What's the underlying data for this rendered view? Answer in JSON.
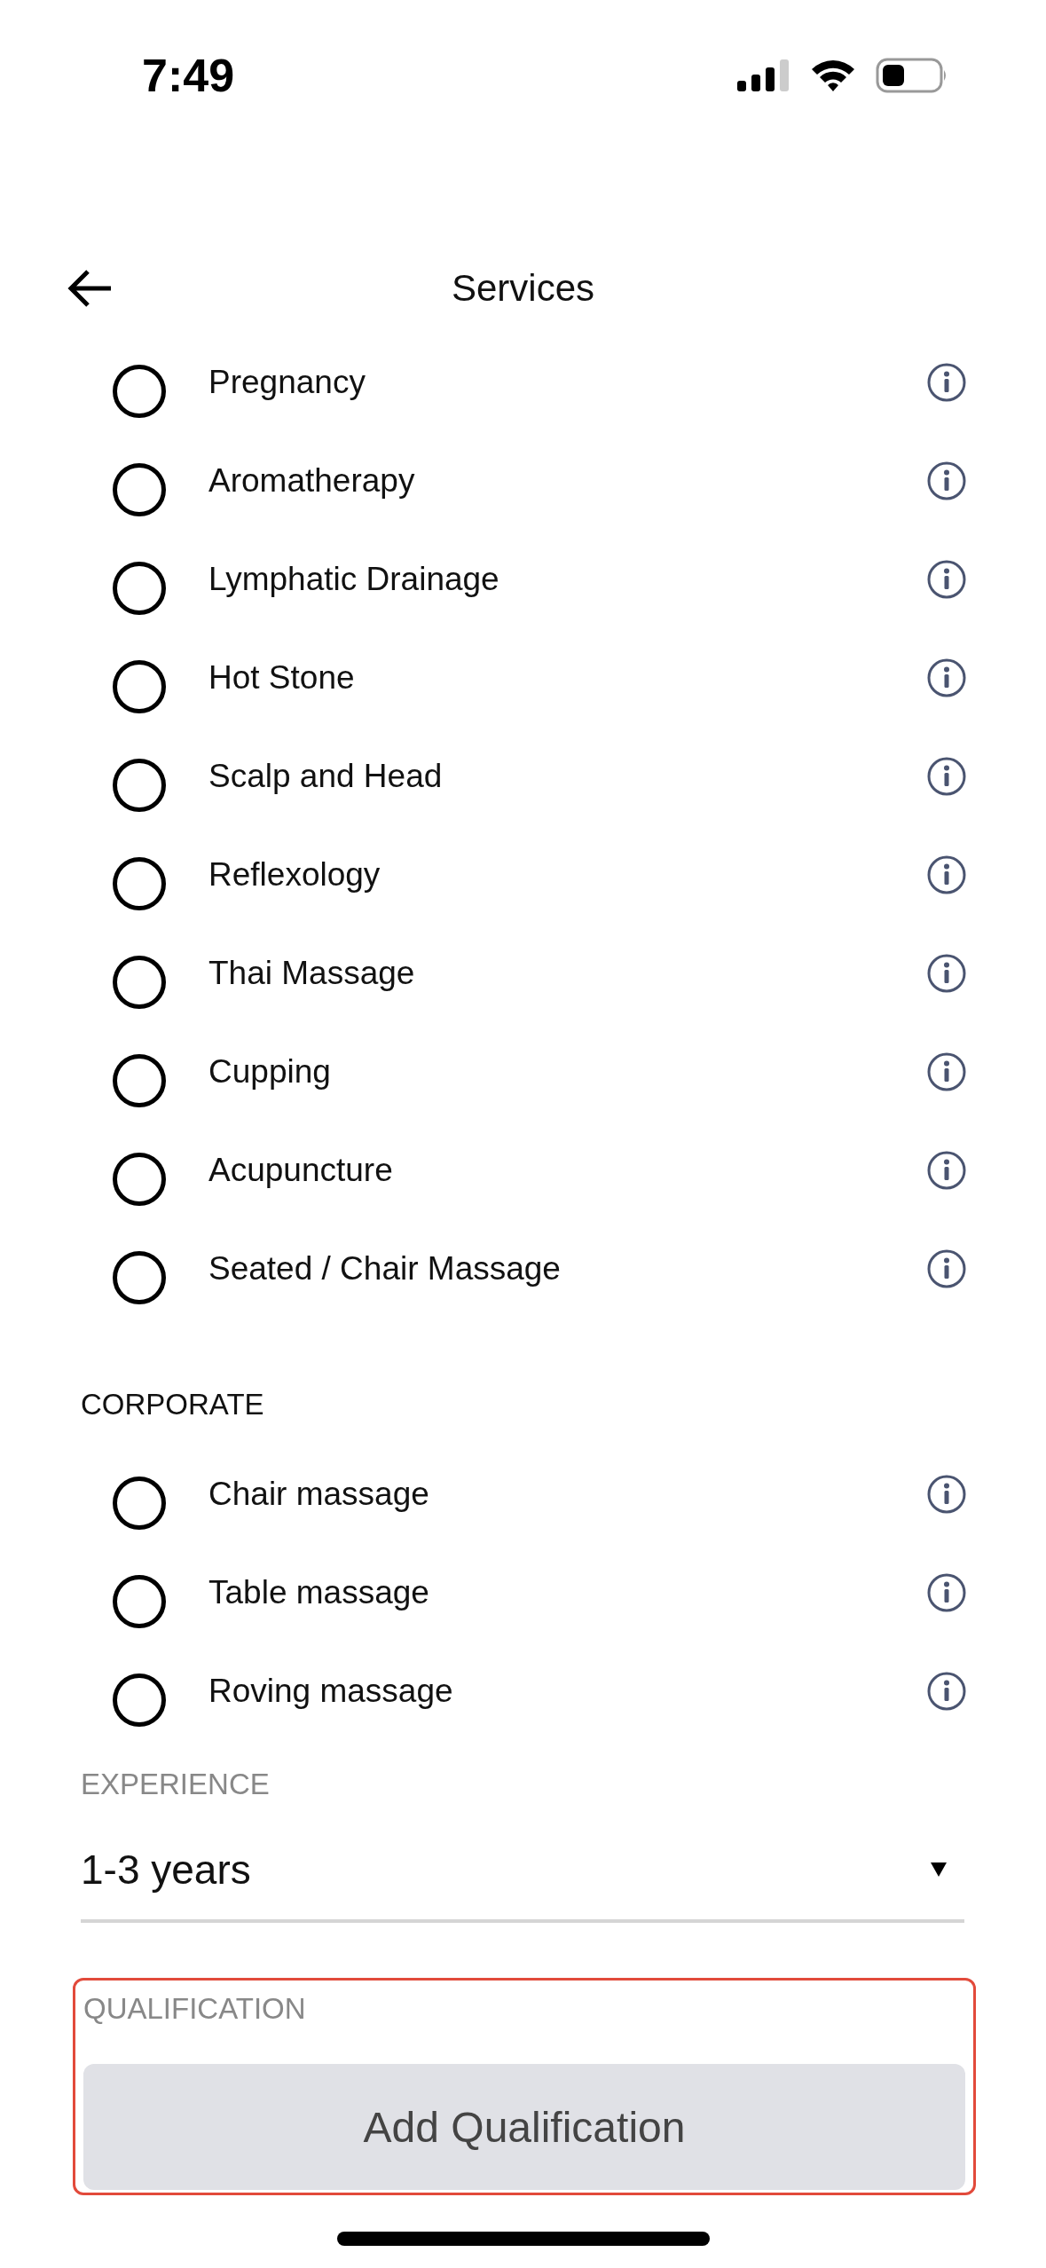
{
  "status_bar": {
    "time": "7:49"
  },
  "header": {
    "title": "Services"
  },
  "sections": [
    {
      "items": [
        {
          "label": "Pregnancy",
          "selected": false
        },
        {
          "label": "Aromatherapy",
          "selected": false
        },
        {
          "label": "Lymphatic Drainage",
          "selected": false
        },
        {
          "label": "Hot Stone",
          "selected": false
        },
        {
          "label": "Scalp and Head",
          "selected": false
        },
        {
          "label": "Reflexology",
          "selected": false
        },
        {
          "label": "Thai Massage",
          "selected": false
        },
        {
          "label": "Cupping",
          "selected": false
        },
        {
          "label": "Acupuncture",
          "selected": false
        },
        {
          "label": "Seated / Chair Massage",
          "selected": false
        }
      ]
    },
    {
      "title": "CORPORATE",
      "items": [
        {
          "label": "Chair massage",
          "selected": false
        },
        {
          "label": "Table massage",
          "selected": false
        },
        {
          "label": "Roving massage",
          "selected": false
        }
      ]
    }
  ],
  "experience": {
    "label": "EXPERIENCE",
    "value": "1-3 years"
  },
  "qualification": {
    "label": "QUALIFICATION",
    "button": "Add Qualification",
    "highlighted": true
  }
}
